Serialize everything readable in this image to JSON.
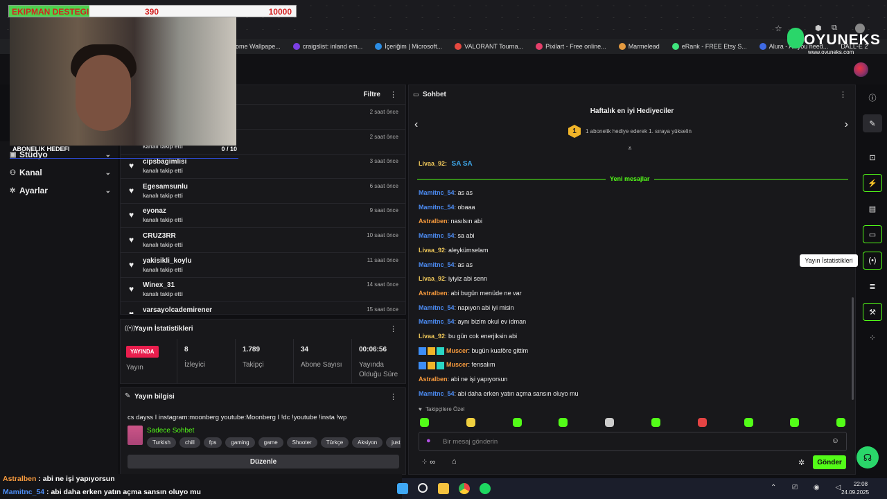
{
  "overlay": {
    "goal_label": "EKIPMAN DESTEGI",
    "goal_current": "390",
    "goal_target": "10000",
    "subs_goal_label": "ABONELIK HEDEFI",
    "subs_goal_value": "0 / 10"
  },
  "brand": {
    "name": "OYUNEKS",
    "url": "www.oyuneks.com"
  },
  "bookmarks": [
    "ome Wallpape...",
    "craigslist: inland em...",
    "İçeriğim | Microsoft...",
    "VALORANT Tourna...",
    "Pixilart - Free online...",
    "Marmelead",
    "eRank - FREE Etsy S...",
    "Alura - All you need...",
    "DALL-E 2"
  ],
  "sidebar": {
    "items": [
      {
        "label": "Stüdyo",
        "icon": "studio-icon"
      },
      {
        "label": "Kanal",
        "icon": "channel-icon"
      },
      {
        "label": "Ayarlar",
        "icon": "gear-icon"
      }
    ]
  },
  "feed": {
    "filter_label": "Filtre",
    "rows": [
      {
        "name": "",
        "sub": "",
        "time": "2 saat önce"
      },
      {
        "name": "",
        "sub": "kanalı takip etti",
        "time": "2 saat önce"
      },
      {
        "name": "cipsbagimlisi",
        "sub": "kanalı takip etti",
        "time": "3 saat önce"
      },
      {
        "name": "Egesamsunlu",
        "sub": "kanalı takip etti",
        "time": "6 saat önce"
      },
      {
        "name": "eyonaz",
        "sub": "kanalı takip etti",
        "time": "9 saat önce"
      },
      {
        "name": "CRUZ3RR",
        "sub": "kanalı takip etti",
        "time": "10 saat önce"
      },
      {
        "name": "yakisikli_koylu",
        "sub": "kanalı takip etti",
        "time": "11 saat önce"
      },
      {
        "name": "Winex_31",
        "sub": "kanalı takip etti",
        "time": "14 saat önce"
      },
      {
        "name": "varsayolcademirener",
        "sub": "",
        "time": "15 saat önce"
      }
    ]
  },
  "stats": {
    "title": "Yayın İstatistikleri",
    "live_badge": "YAYINDA",
    "live_label": "Yayın",
    "viewers": "8",
    "viewers_label": "İzleyici",
    "followers": "1.789",
    "followers_label": "Takipçi",
    "subs": "34",
    "subs_label": "Abone Sayısı",
    "uptime": "00:06:56",
    "uptime_label": "Yayında Olduğu Süre"
  },
  "info": {
    "title": "Yayın bilgisi",
    "stream_title": "cs dayss I instagram:moonberg youtube:Moonberg I !dc !youtube !insta !wp",
    "category": "Sadece Sohbet",
    "tags": [
      "Turkish",
      "chill",
      "fps",
      "gaming",
      "game",
      "Shooter",
      "Türkçe",
      "Aksiyon",
      "justchattin"
    ],
    "edit_button": "Düzenle"
  },
  "chat": {
    "title": "Sohbet",
    "gifters_title": "Haftalık en iyi Hediyeciler",
    "gifters_rank": "1",
    "gifters_text": "1 abonelik hediye ederek 1. sıraya yükselin",
    "pinned_user": "Livaa_92:",
    "pinned_text": "SA SA",
    "new_messages": "Yeni mesajlar",
    "messages": [
      {
        "user": "Mamitnc_54",
        "text": ": as as",
        "color": "#4d8ef7"
      },
      {
        "user": "Mamitnc_54",
        "text": ": obaaa",
        "color": "#4d8ef7"
      },
      {
        "user": "Astralben",
        "text": ": nasılsın abi",
        "color": "#f79a3d"
      },
      {
        "user": "Mamitnc_54",
        "text": ": sa abi",
        "color": "#4d8ef7"
      },
      {
        "user": "Livaa_92",
        "text": ": aleykümselam",
        "color": "#f0c85a"
      },
      {
        "user": "Mamitnc_54",
        "text": ": as as",
        "color": "#4d8ef7"
      },
      {
        "user": "Livaa_92",
        "text": ": iyiyiz abi senn",
        "color": "#f0c85a"
      },
      {
        "user": "Astralben",
        "text": ": abi bugün menüde ne var",
        "color": "#f79a3d"
      },
      {
        "user": "Mamitnc_54",
        "text": ": napıyon abi iyi misin",
        "color": "#4d8ef7"
      },
      {
        "user": "Mamitnc_54",
        "text": ": aynı bizim okul ev idman",
        "color": "#4d8ef7"
      },
      {
        "user": "Livaa_92",
        "text": ": bu gün cok enerjiksin abi",
        "color": "#f0c85a"
      },
      {
        "user": "Muscer",
        "text": ": bugün kuaföre gittim",
        "color": "#f79a3d"
      },
      {
        "user": "Muscer",
        "text": ": fensalım",
        "color": "#f79a3d"
      },
      {
        "user": "Astralben",
        "text": ": abi ne işi yapıyorsun",
        "color": "#f79a3d"
      },
      {
        "user": "Mamitnc_54",
        "text": ": abi daha erken yatın açma sansın oluyo mu",
        "color": "#4d8ef7"
      }
    ],
    "followers_only": "Takipçilere Özel",
    "input_placeholder": "Bir mesaj gönderin",
    "send_button": "Gönder"
  },
  "tooltip": "Yayın İstatistikleri",
  "bottom_chat": [
    {
      "user": "Astralben",
      "text": " : abi ne işi yapıyorsun",
      "color": "#f79a3d"
    },
    {
      "user": "Mamitnc_54",
      "text": " : abi daha erken yatın açma sansın oluyo mu",
      "color": "#4d8ef7"
    }
  ],
  "taskbar": {
    "time": "22:08",
    "date": "24.09.2025"
  },
  "colors": {
    "accent": "#53fc18",
    "live": "#e91e4d"
  }
}
